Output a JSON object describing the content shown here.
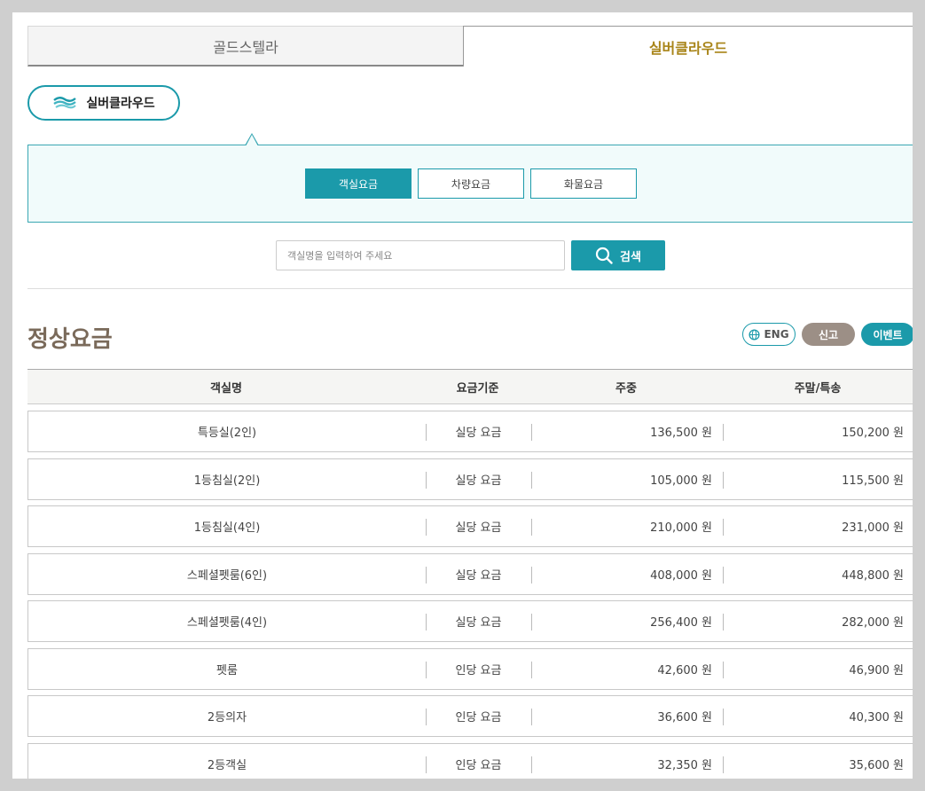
{
  "ship_tabs": [
    {
      "label": "골드스텔라"
    },
    {
      "label": "실버클라우드"
    }
  ],
  "ship_badge": {
    "label": "실버클라우드",
    "icon": "wave-logo-icon"
  },
  "categories": [
    {
      "label": "객실요금"
    },
    {
      "label": "차량요금"
    },
    {
      "label": "화물요금"
    }
  ],
  "search": {
    "placeholder": "객실명을 입력하여 주세요",
    "button_label": "검색"
  },
  "section": {
    "title": "정상요금"
  },
  "actions": {
    "eng_label": "ENG",
    "report_label": "신고",
    "event_label": "이벤트"
  },
  "colors": {
    "accent": "#1b9aaa",
    "gold": "#a88418",
    "title": "#7a6a5a",
    "report": "#9c8f86"
  },
  "table": {
    "headers": [
      "객실명",
      "요금기준",
      "주중",
      "주말/특송"
    ],
    "rows": [
      {
        "name": "특등실(2인)",
        "basis": "실당 요금",
        "weekday": "136,500 원",
        "weekend": "150,200 원"
      },
      {
        "name": "1등침실(2인)",
        "basis": "실당 요금",
        "weekday": "105,000 원",
        "weekend": "115,500 원"
      },
      {
        "name": "1등침실(4인)",
        "basis": "실당 요금",
        "weekday": "210,000 원",
        "weekend": "231,000 원"
      },
      {
        "name": "스페셜펫룸(6인)",
        "basis": "실당 요금",
        "weekday": "408,000 원",
        "weekend": "448,800 원"
      },
      {
        "name": "스페셜펫룸(4인)",
        "basis": "실당 요금",
        "weekday": "256,400 원",
        "weekend": "282,000 원"
      },
      {
        "name": "펫룸",
        "basis": "인당 요금",
        "weekday": "42,600 원",
        "weekend": "46,900 원"
      },
      {
        "name": "2등의자",
        "basis": "인당 요금",
        "weekday": "36,600 원",
        "weekend": "40,300 원"
      },
      {
        "name": "2등객실",
        "basis": "인당 요금",
        "weekday": "32,350 원",
        "weekend": "35,600 원"
      }
    ]
  }
}
